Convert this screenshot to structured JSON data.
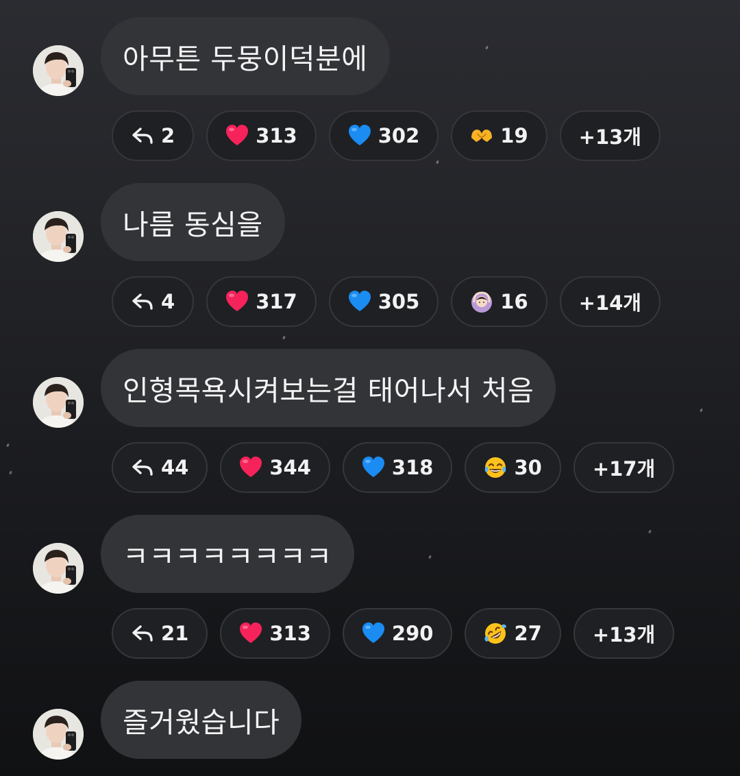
{
  "messages": [
    {
      "text": "아무튼 두뭉이덕분에",
      "reactions": {
        "reply": {
          "icon": "reply-arrow-icon",
          "count": "2"
        },
        "red_heart": {
          "icon": "red-heart-icon",
          "count": "313"
        },
        "blue_heart": {
          "icon": "blue-heart-icon",
          "count": "302"
        },
        "emoji": {
          "icon": "heart-hands-icon",
          "count": "19"
        },
        "more": {
          "label": "+13개"
        }
      }
    },
    {
      "text": "나름 동심을",
      "reactions": {
        "reply": {
          "icon": "reply-arrow-icon",
          "count": "4"
        },
        "red_heart": {
          "icon": "red-heart-icon",
          "count": "317"
        },
        "blue_heart": {
          "icon": "blue-heart-icon",
          "count": "305"
        },
        "emoji": {
          "icon": "person-gesturing-ok-icon",
          "count": "16"
        },
        "more": {
          "label": "+14개"
        }
      }
    },
    {
      "text": "인형목욕시켜보는걸 태어나서 처음",
      "reactions": {
        "reply": {
          "icon": "reply-arrow-icon",
          "count": "44"
        },
        "red_heart": {
          "icon": "red-heart-icon",
          "count": "344"
        },
        "blue_heart": {
          "icon": "blue-heart-icon",
          "count": "318"
        },
        "emoji": {
          "icon": "tears-of-joy-icon",
          "count": "30"
        },
        "more": {
          "label": "+17개"
        }
      }
    },
    {
      "text": "ㅋㅋㅋㅋㅋㅋㅋㅋ",
      "reactions": {
        "reply": {
          "icon": "reply-arrow-icon",
          "count": "21"
        },
        "red_heart": {
          "icon": "red-heart-icon",
          "count": "313"
        },
        "blue_heart": {
          "icon": "blue-heart-icon",
          "count": "290"
        },
        "emoji": {
          "icon": "rofl-icon",
          "count": "27"
        },
        "more": {
          "label": "+13개"
        }
      }
    },
    {
      "text": "즐거웠습니다"
    }
  ],
  "colors": {
    "bubble": "#333438",
    "chip_background": "#1f2024",
    "chip_border": "#36373c",
    "red_heart": "#f6235b",
    "blue_heart": "#1a8cf2"
  }
}
